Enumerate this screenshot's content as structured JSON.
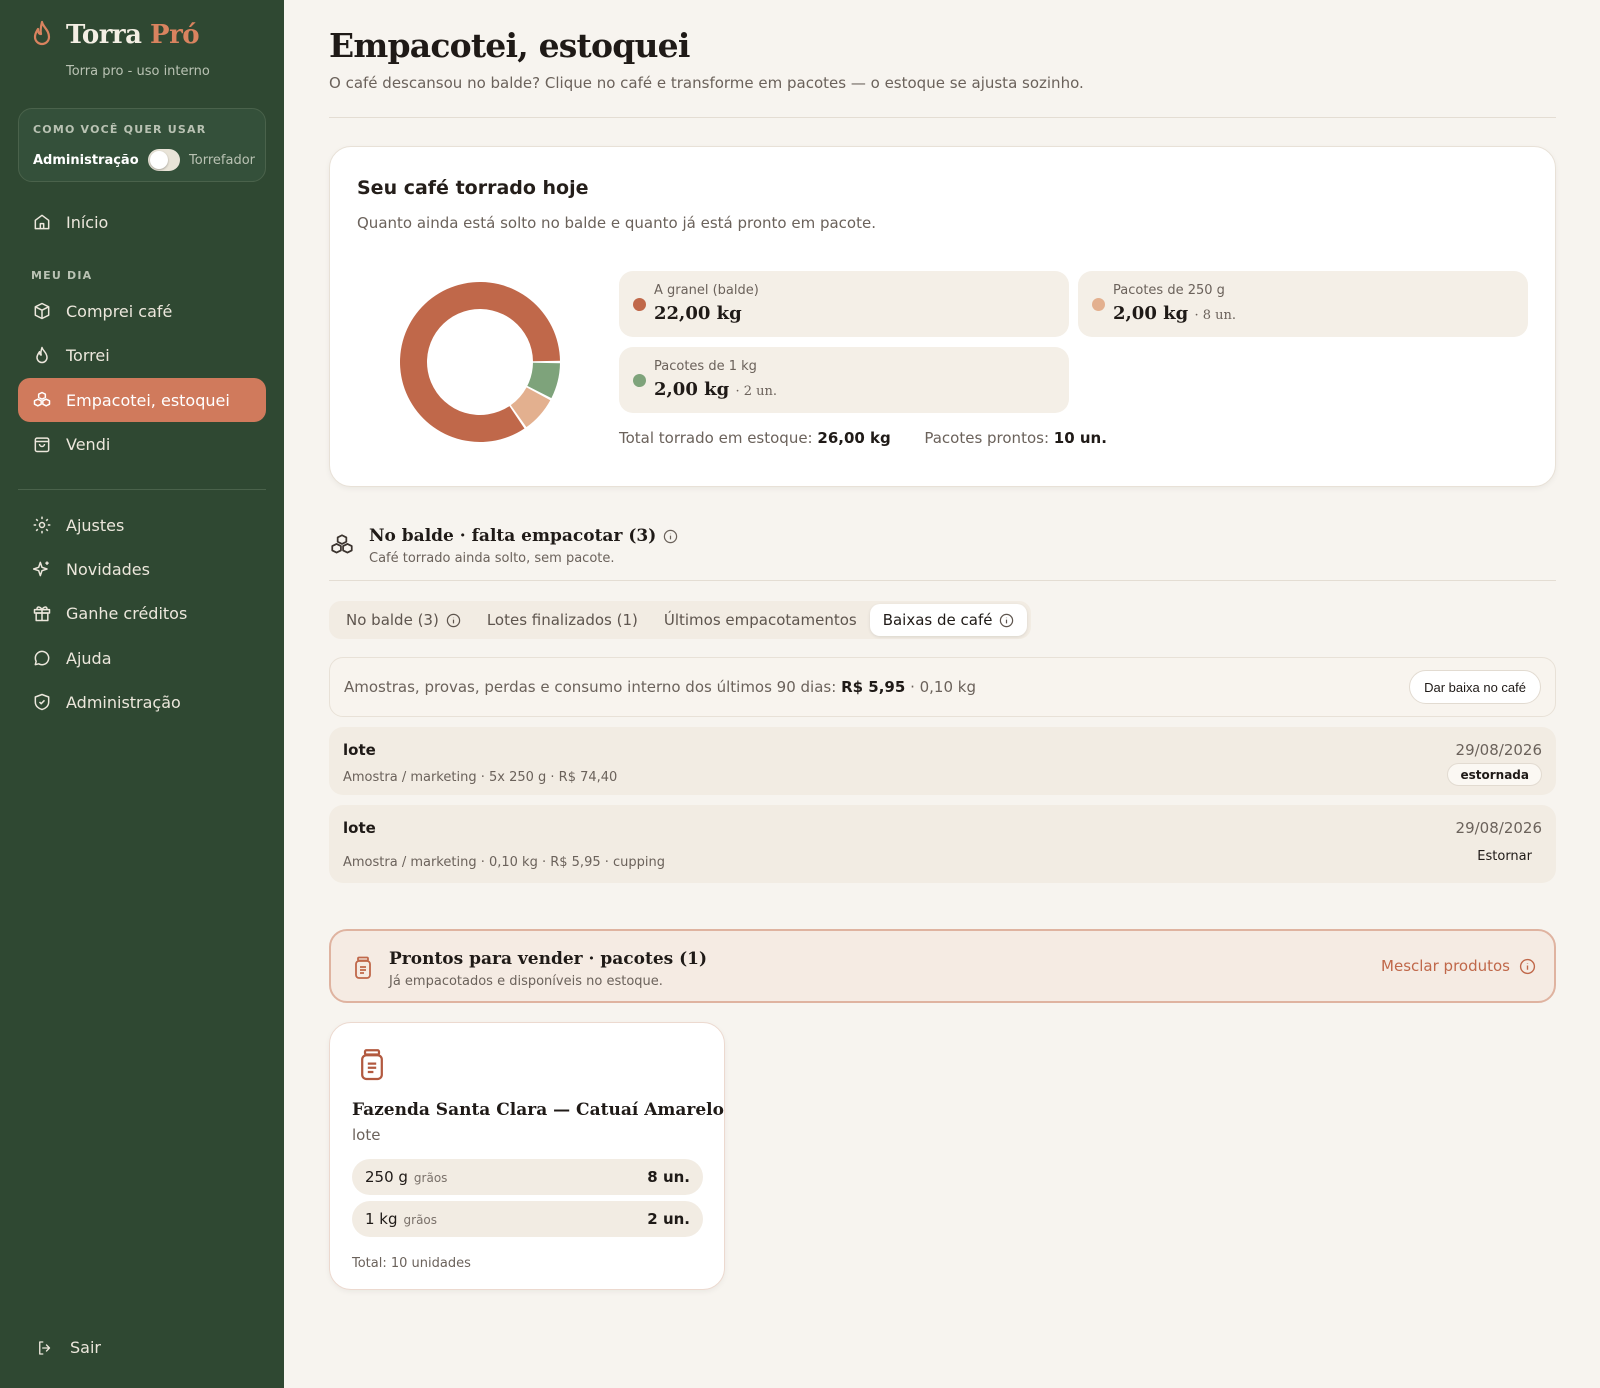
{
  "brand": {
    "name_main": "Torra",
    "name_accent": "Pró",
    "subtitle": "Torra pro - uso interno"
  },
  "mode": {
    "title": "COMO VOCÊ QUER USAR",
    "left": "Administração",
    "right": "Torrefador"
  },
  "nav": {
    "inicio": "Início",
    "section": "MEU DIA",
    "comprei": "Comprei café",
    "torrei": "Torrei",
    "empacotei": "Empacotei, estoquei",
    "vendi": "Vendi",
    "ajustes": "Ajustes",
    "novidades": "Novidades",
    "creditos": "Ganhe créditos",
    "ajuda": "Ajuda",
    "admin": "Administração",
    "sair": "Sair"
  },
  "page": {
    "title": "Empacotei, estoquei",
    "subtitle": "O café descansou no balde? Clique no café e transforme em pacotes — o estoque se ajusta sozinho."
  },
  "today": {
    "title": "Seu café torrado hoje",
    "desc": "Quanto ainda está solto no balde e quanto já está pronto em pacote.",
    "stats": [
      {
        "label": "A granel (balde)",
        "value": "22,00 kg",
        "extra": "",
        "color": "#c0684a"
      },
      {
        "label": "Pacotes de 250 g",
        "value": "2,00 kg",
        "extra": "· 8 un.",
        "color": "#e3b08f"
      },
      {
        "label": "Pacotes de 1 kg",
        "value": "2,00 kg",
        "extra": "· 2 un.",
        "color": "#7ea37b"
      }
    ],
    "total_label": "Total torrado em estoque:",
    "total_value": "26,00 kg",
    "ready_label": "Pacotes prontos:",
    "ready_value": "10 un."
  },
  "chart_data": {
    "type": "pie",
    "categories": [
      "A granel (balde)",
      "Pacotes de 250 g",
      "Pacotes de 1 kg"
    ],
    "values": [
      22.0,
      2.0,
      2.0
    ],
    "colors": [
      "#c0684a",
      "#e3b08f",
      "#7ea37b"
    ],
    "title": ""
  },
  "bucket": {
    "title": "No balde · falta empacotar (3)",
    "subtitle": "Café torrado ainda solto, sem pacote."
  },
  "tabs": [
    {
      "label": "No balde (3)"
    },
    {
      "label": "Lotes finalizados (1)"
    },
    {
      "label": "Últimos empacotamentos"
    },
    {
      "label": "Baixas de café"
    }
  ],
  "summary": {
    "text": "Amostras, provas, perdas e consumo interno dos últimos 90 dias:",
    "amount": "R$ 5,95",
    "weight": "· 0,10 kg",
    "button": "Dar baixa no café"
  },
  "entries": [
    {
      "title": "lote",
      "detail": "Amostra / marketing · 5x 250 g · R$ 74,40",
      "date": "29/08/2026",
      "status": "estornada"
    },
    {
      "title": "lote",
      "detail": "Amostra / marketing · 0,10 kg · R$ 5,95 · cupping",
      "date": "29/08/2026",
      "action": "Estornar"
    }
  ],
  "ready": {
    "title": "Prontos para vender · pacotes (1)",
    "subtitle": "Já empacotados e disponíveis no estoque.",
    "merge": "Mesclar produtos"
  },
  "product": {
    "name": "Fazenda Santa Clara — Catuaí Amarelo",
    "lot": "lote",
    "packages": [
      {
        "size": "250 g",
        "kind": "grãos",
        "qty": "8 un."
      },
      {
        "size": "1 kg",
        "kind": "grãos",
        "qty": "2 un."
      }
    ],
    "total": "Total: 10 unidades"
  }
}
